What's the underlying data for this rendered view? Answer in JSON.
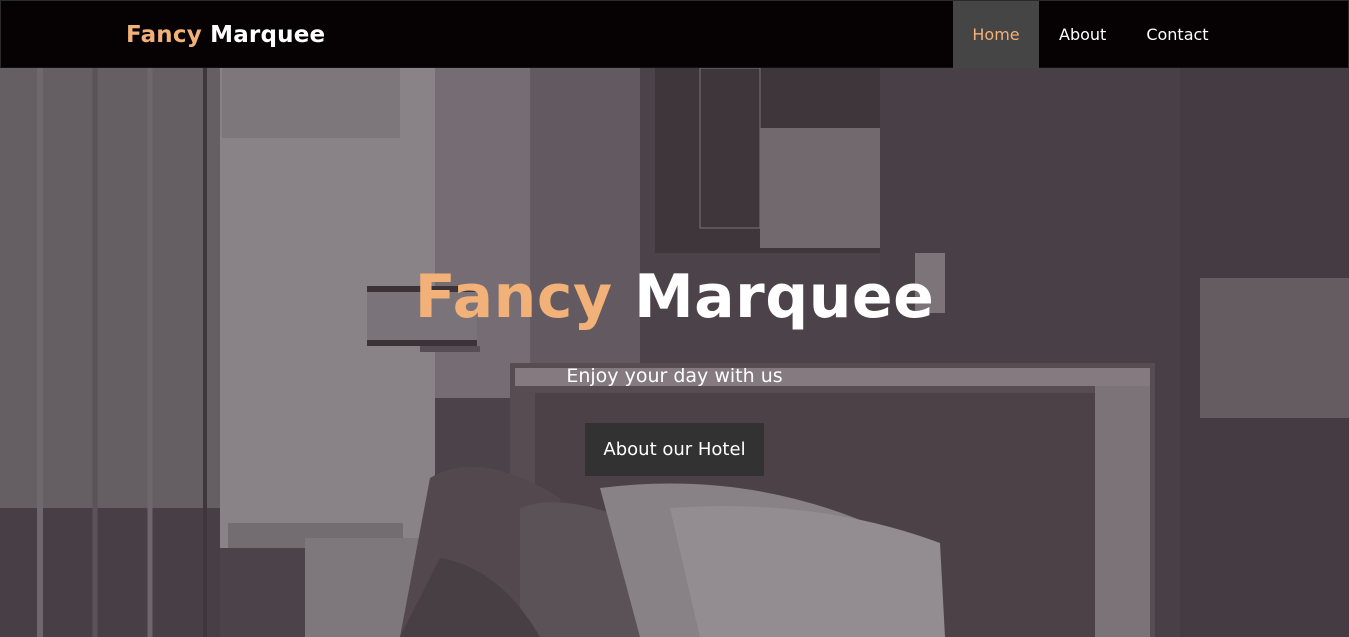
{
  "brand": {
    "accent": "Fancy",
    "rest": "Marquee"
  },
  "nav": {
    "items": [
      {
        "label": "Home",
        "active": true
      },
      {
        "label": "About",
        "active": false
      },
      {
        "label": "Contact",
        "active": false
      }
    ]
  },
  "hero": {
    "title_accent": "Fancy",
    "title_rest": "Marquee",
    "subtitle": "Enjoy your day with us",
    "button_label": "About our Hotel"
  },
  "colors": {
    "accent": "#f2b178",
    "nav_bg": "#060203",
    "nav_active_bg": "#454545",
    "button_bg": "#323232",
    "overlay": "#4e464c"
  }
}
